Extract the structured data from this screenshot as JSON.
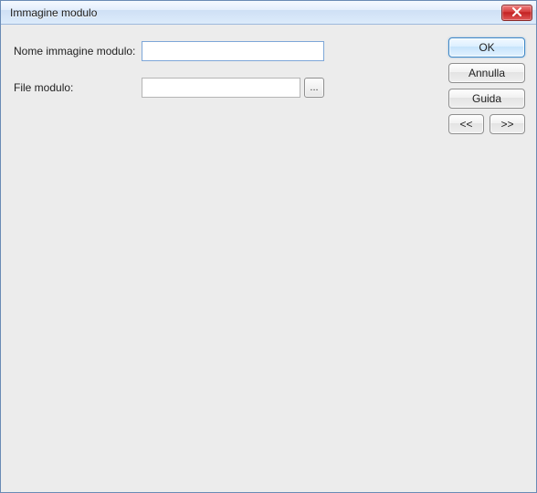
{
  "window": {
    "title": "Immagine modulo"
  },
  "form": {
    "name_label": "Nome immagine modulo:",
    "name_value": "",
    "file_label": "File modulo:",
    "file_value": "",
    "browse_label": "..."
  },
  "buttons": {
    "ok": "OK",
    "cancel": "Annulla",
    "help": "Guida",
    "prev": "<<",
    "next": ">>"
  }
}
